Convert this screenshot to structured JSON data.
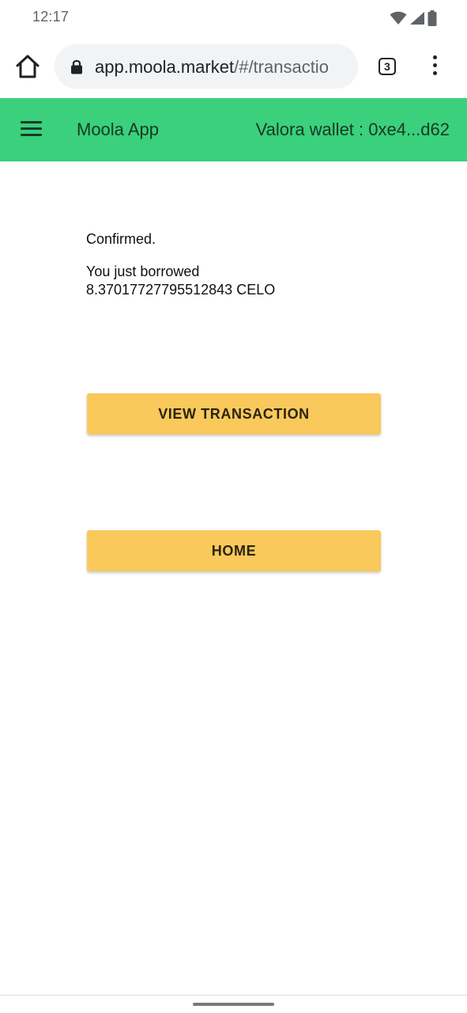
{
  "status_bar": {
    "time": "12:17",
    "icons": [
      "wifi-icon",
      "signal-icon",
      "battery-icon"
    ]
  },
  "browser": {
    "url_host": "app.moola.market",
    "url_path": "/#/transactio",
    "tab_count": "3",
    "icons": [
      "home-icon",
      "lock-icon",
      "more-vert-icon"
    ]
  },
  "app_header": {
    "title": "Moola App",
    "wallet": "Valora wallet : 0xe4...d62",
    "background_color": "#3ad07c"
  },
  "content": {
    "status": "Confirmed.",
    "message_line1": "You just borrowed",
    "message_line2": "8.37017727795512843 CELO"
  },
  "buttons": {
    "view_transaction": "VIEW TRANSACTION",
    "home": "HOME",
    "button_color": "#f9c95c"
  }
}
